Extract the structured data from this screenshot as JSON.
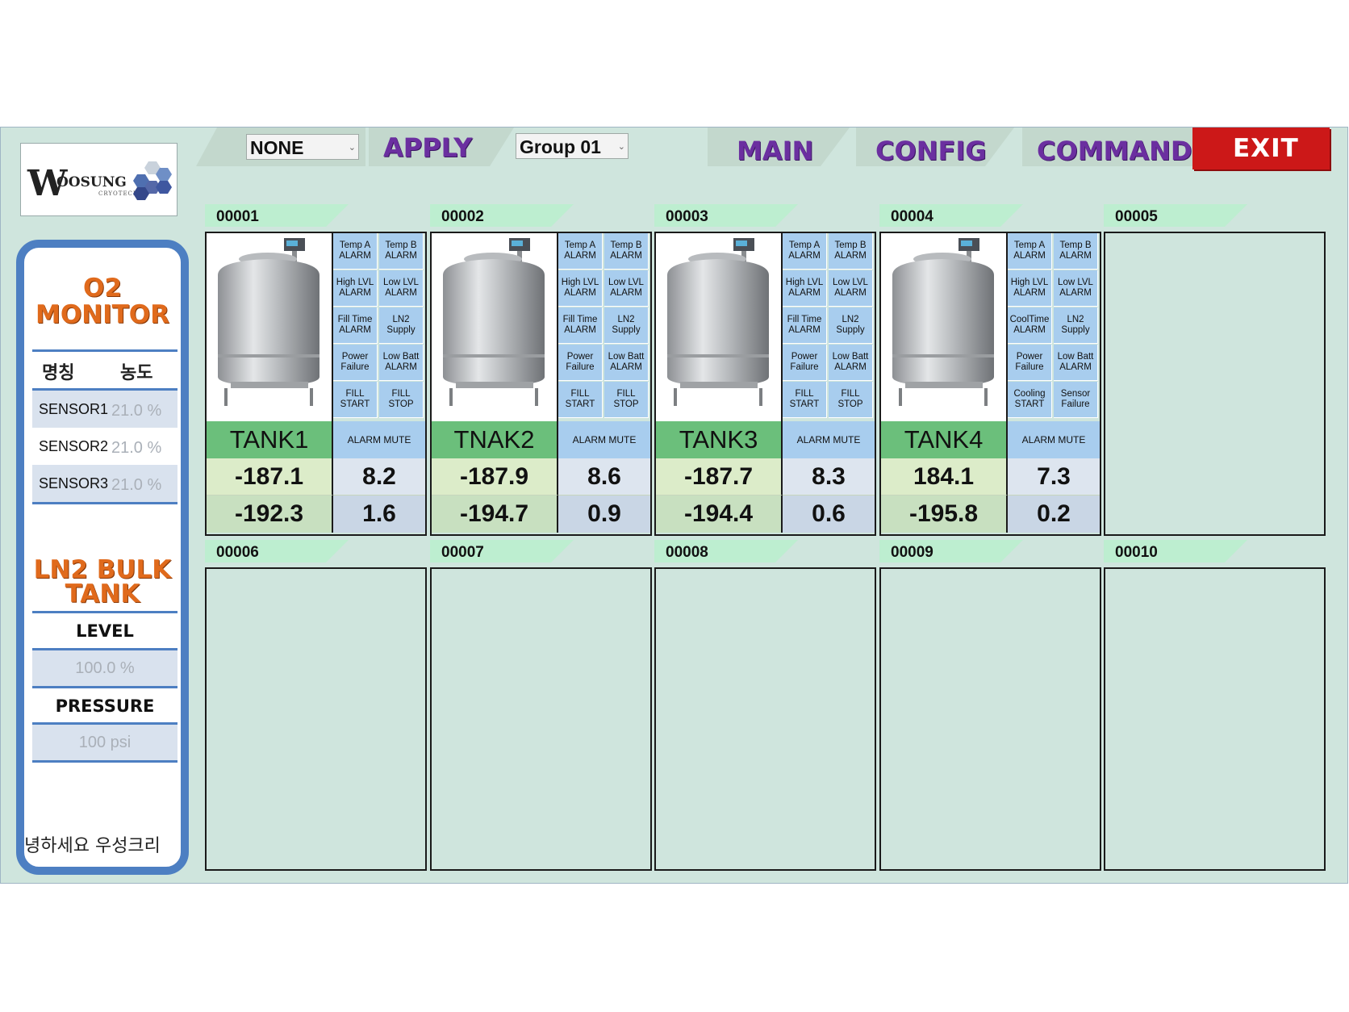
{
  "logo": {
    "word_big": "W",
    "word_rest": "OOSUNG",
    "sub": "CRYOTECH"
  },
  "left_panel": {
    "o2_title_line1": "O2",
    "o2_title_line2": "MONITOR",
    "col_name": "명칭",
    "col_conc": "농도",
    "sensors": [
      {
        "name": "SENSOR1",
        "value": "21.0 %"
      },
      {
        "name": "SENSOR2",
        "value": "21.0 %"
      },
      {
        "name": "SENSOR3",
        "value": "21.0 %"
      }
    ],
    "bulk_title_line1": "LN2 BULK",
    "bulk_title_line2": "TANK",
    "level_label": "LEVEL",
    "level_value": "100.0 %",
    "pressure_label": "PRESSURE",
    "pressure_value": "100 psi",
    "marquee": "녕하세요 우성크리"
  },
  "topbar": {
    "dropdown1": "NONE",
    "apply": "APPLY",
    "dropdown2": "Group 01",
    "main": "MAIN",
    "config": "CONFIG",
    "command": "COMMAND",
    "exit": "EXIT"
  },
  "cards": [
    {
      "id": "00001",
      "name": "TANK1",
      "mute": "ALARM MUTE",
      "temp_a": "-187.1",
      "temp_b": "-192.3",
      "val1": "8.2",
      "val2": "1.6",
      "buttons": [
        "Temp A\nALARM",
        "Temp B\nALARM",
        "High LVL\nALARM",
        "Low LVL\nALARM",
        "Fill Time\nALARM",
        "LN2\nSupply",
        "Power\nFailure",
        "Low Batt\nALARM",
        "FILL\nSTART",
        "FILL\nSTOP"
      ]
    },
    {
      "id": "00002",
      "name": "TNAK2",
      "mute": "ALARM MUTE",
      "temp_a": "-187.9",
      "temp_b": "-194.7",
      "val1": "8.6",
      "val2": "0.9",
      "buttons": [
        "Temp A\nALARM",
        "Temp B\nALARM",
        "High LVL\nALARM",
        "Low LVL\nALARM",
        "Fill Time\nALARM",
        "LN2\nSupply",
        "Power\nFailure",
        "Low Batt\nALARM",
        "FILL\nSTART",
        "FILL\nSTOP"
      ]
    },
    {
      "id": "00003",
      "name": "TANK3",
      "mute": "ALARM MUTE",
      "temp_a": "-187.7",
      "temp_b": "-194.4",
      "val1": "8.3",
      "val2": "0.6",
      "buttons": [
        "Temp A\nALARM",
        "Temp B\nALARM",
        "High LVL\nALARM",
        "Low LVL\nALARM",
        "Fill Time\nALARM",
        "LN2\nSupply",
        "Power\nFailure",
        "Low Batt\nALARM",
        "FILL\nSTART",
        "FILL\nSTOP"
      ]
    },
    {
      "id": "00004",
      "name": "TANK4",
      "mute": "ALARM MUTE",
      "temp_a": "184.1",
      "temp_b": "-195.8",
      "val1": "7.3",
      "val2": "0.2",
      "buttons": [
        "Temp A\nALARM",
        "Temp B\nALARM",
        "High LVL\nALARM",
        "Low LVL\nALARM",
        "CoolTime\nALARM",
        "LN2\nSupply",
        "Power\nFailure",
        "Low Batt\nALARM",
        "Cooling\nSTART",
        "Sensor\nFailure"
      ]
    }
  ],
  "empty_cards": [
    "00005",
    "00006",
    "00007",
    "00008",
    "00009",
    "00010"
  ]
}
